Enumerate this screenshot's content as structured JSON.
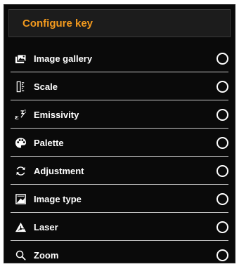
{
  "header": {
    "title": "Configure key"
  },
  "items": [
    {
      "label": "Image gallery",
      "icon": "image-gallery-icon",
      "selected": false
    },
    {
      "label": "Scale",
      "icon": "scale-icon",
      "selected": false
    },
    {
      "label": "Emissivity",
      "icon": "emissivity-icon",
      "selected": false
    },
    {
      "label": "Palette",
      "icon": "palette-icon",
      "selected": false
    },
    {
      "label": "Adjustment",
      "icon": "adjustment-icon",
      "selected": false
    },
    {
      "label": "Image type",
      "icon": "image-type-icon",
      "selected": false
    },
    {
      "label": "Laser",
      "icon": "laser-icon",
      "selected": false
    },
    {
      "label": "Zoom",
      "icon": "zoom-icon",
      "selected": false
    }
  ],
  "colors": {
    "accent": "#f39a1e",
    "background": "#0a0a0a",
    "header_background": "#1c1c1c",
    "text": "#ffffff",
    "divider": "#c8c8c8"
  }
}
